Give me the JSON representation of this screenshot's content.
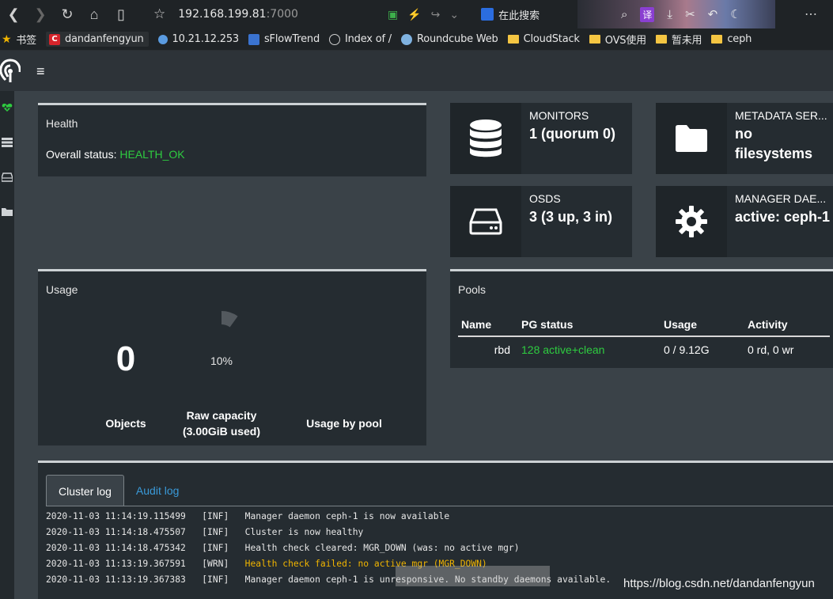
{
  "browser": {
    "url_host": "192.168.199.81",
    "url_port": ":7000",
    "search_label": "在此搜索"
  },
  "bookmarks": {
    "items": [
      {
        "label": "书签",
        "icon": "star-icon"
      },
      {
        "label": "dandanfengyun",
        "icon": "csdn-icon"
      },
      {
        "label": "10.21.12.253",
        "icon": "network-icon"
      },
      {
        "label": "sFlowTrend",
        "icon": "sflow-icon"
      },
      {
        "label": "Index of /",
        "icon": "globe-icon"
      },
      {
        "label": "Roundcube Web",
        "icon": "roundcube-icon"
      },
      {
        "label": "CloudStack",
        "icon": "folder-icon"
      },
      {
        "label": "OVS使用",
        "icon": "folder-icon"
      },
      {
        "label": "暂未用",
        "icon": "folder-icon"
      },
      {
        "label": "ceph",
        "icon": "folder-icon"
      }
    ]
  },
  "health": {
    "title": "Health",
    "status_label": "Overall status: ",
    "status_value": "HEALTH_OK",
    "status_color": "#2ecc40"
  },
  "cards": {
    "monitors": {
      "label": "MONITORS",
      "value": "1 (quorum 0)",
      "icon": "database-icon"
    },
    "metadata": {
      "label": "METADATA SER...",
      "value_line1": "no",
      "value_line2": "filesystems",
      "icon": "folder-icon"
    },
    "osds": {
      "label": "OSDS",
      "value": "3 (3 up, 3 in)",
      "icon": "hard-drive-icon"
    },
    "manager": {
      "label": "MANAGER DAE...",
      "value": "active: ceph-1",
      "icon": "gear-icon"
    }
  },
  "usage": {
    "title": "Usage",
    "objects_value": "0",
    "objects_label": "Objects",
    "raw_capacity_label": "Raw capacity",
    "raw_capacity_used": "(3.00GiB used)",
    "raw_capacity_percent": "10%",
    "usage_fraction": 0.1,
    "usage_by_pool_label": "Usage by pool"
  },
  "pools": {
    "title": "Pools",
    "headers": [
      "Name",
      "PG status",
      "Usage",
      "Activity"
    ],
    "rows": [
      {
        "name": "rbd",
        "pg_status": "128 active+clean",
        "usage": "0 / 9.12G",
        "activity": "0 rd, 0 wr"
      }
    ]
  },
  "log": {
    "tabs": [
      "Cluster log",
      "Audit log"
    ],
    "active_tab": "Cluster log",
    "lines": [
      {
        "time": "2020-11-03 11:14:19.115499",
        "level": "[INF]",
        "message": "Manager daemon ceph-1 is now available"
      },
      {
        "time": "2020-11-03 11:14:18.475507",
        "level": "[INF]",
        "message": "Cluster is now healthy"
      },
      {
        "time": "2020-11-03 11:14:18.475342",
        "level": "[INF]",
        "message": "Health check cleared: MGR_DOWN (was: no active mgr)"
      },
      {
        "time": "2020-11-03 11:13:19.367591",
        "level": "[WRN]",
        "message": "Health check failed: no active mgr (MGR_DOWN)"
      },
      {
        "time": "2020-11-03 11:13:19.367383",
        "level": "[INF]",
        "message": "Manager daemon ceph-1 is unresponsive. No standby daemons available."
      }
    ]
  },
  "watermark": "https://blog.csdn.net/dandanfengyun"
}
